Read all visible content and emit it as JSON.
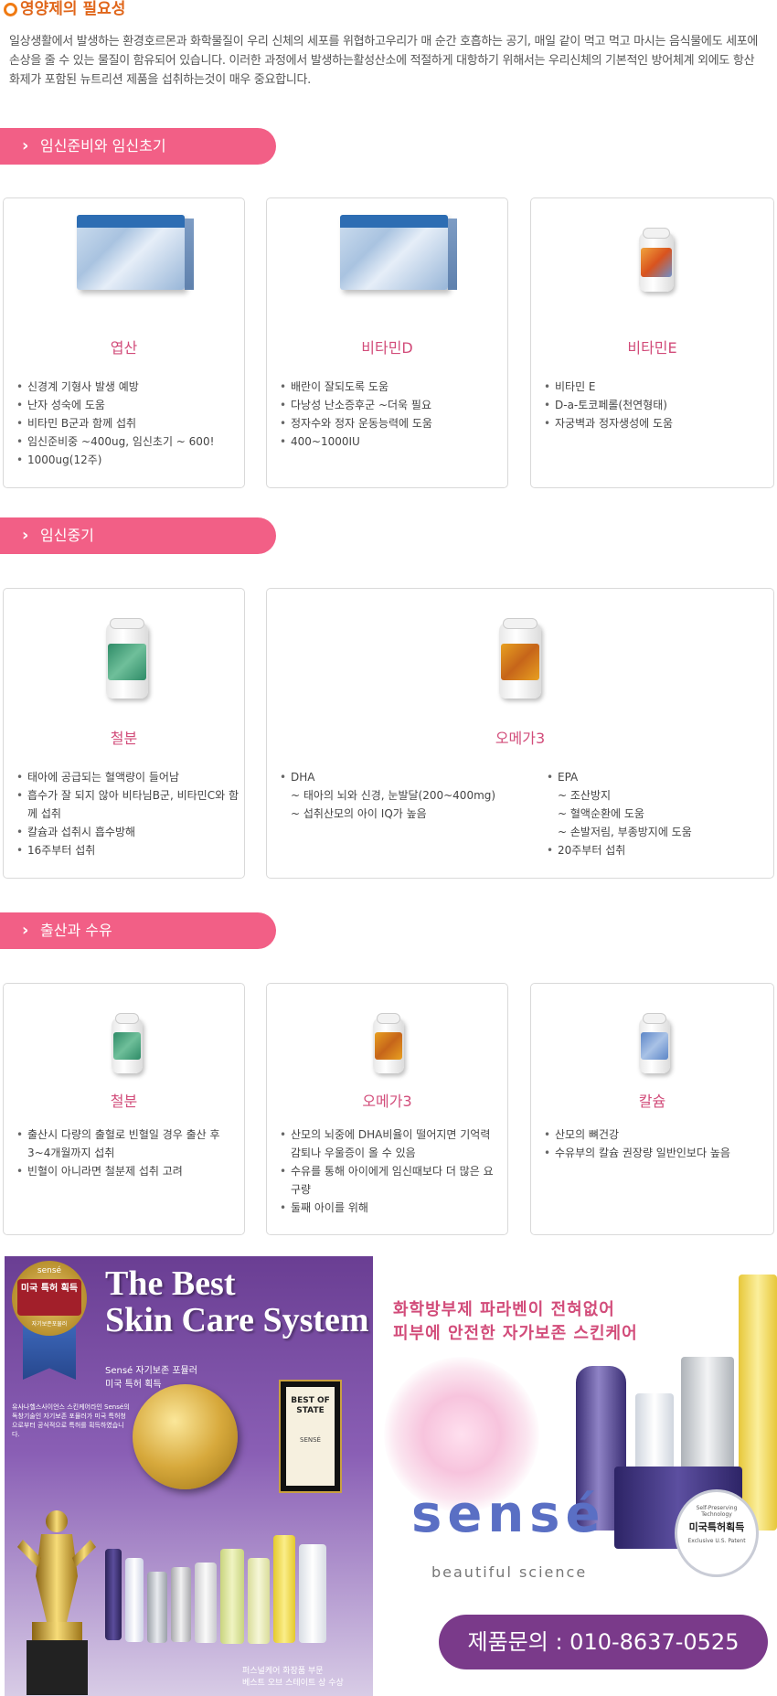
{
  "header": {
    "title": "영양제의 필요성",
    "intro": "일상생활에서 발생하는 환경호르몬과 화학물질이 우리 신체의 세포를 위협하고우리가 매 순간 호흡하는 공기, 매일 같이 먹고 먹고 마시는 음식물에도 세포에 손상을 줄 수 있는 물질이 함유되어 있습니다. 이러한 과정에서 발생하는활성산소에 적절하게 대항하기 위해서는 우리신체의 기본적인 방어체계 외에도 항산화제가 포함된 뉴트리션 제품을 섭취하는것이 매우 중요합니다."
  },
  "sections": [
    {
      "title": "임신준비와 임신초기",
      "cards": [
        {
          "name": "엽산",
          "items": [
            "신경계 기형사 발생 예방",
            "난자 성숙에 도움",
            "비타민 B군과 함께 섭취",
            "임신준비중 ~400ug, 임신초기 ~ 600!",
            "1000ug(12주)"
          ]
        },
        {
          "name": "비타민D",
          "items": [
            "배란이 잘되도록 도움",
            "다낭성 난소증후군 ~더욱 필요",
            "정자수와 정자 운동능력에 도움",
            "400~1000IU"
          ]
        },
        {
          "name": "비타민E",
          "items": [
            "비타민 E",
            "D-a-토코페롤(천연형태)",
            "자궁벽과 정자생성에 도움"
          ]
        }
      ]
    },
    {
      "title": "임신중기",
      "cards": [
        {
          "name": "철분",
          "items": [
            "태아에 공급되는 혈액량이 들어남",
            "흡수가 잘 되지 않아 비타님B군, 비타민C와 함께 섭취",
            "칼슘과 섭취시 흡수방해",
            "16주부터 섭취"
          ]
        },
        {
          "name": "오메가3",
          "dha": {
            "title": "DHA",
            "subs": [
              "~ 태아의 뇌와 신경, 눈발달(200~400mg)",
              "~ 섭취산모의 아이 IQ가 높음"
            ]
          },
          "epa": {
            "title": "EPA",
            "subs": [
              "~ 조산방지",
              "~ 혈액순환에 도움",
              "~ 손발저림, 부종방지에 도움"
            ],
            "extra": "20주부터 섭취"
          }
        }
      ]
    },
    {
      "title": "출산과 수유",
      "cards": [
        {
          "name": "철분",
          "items": [
            "출산시 다량의 출혈로 빈혈일 경우 출산 후 3~4개월까지 섭취",
            "빈혈이 아니라면 철분제 섭취 고려"
          ]
        },
        {
          "name": "오메가3",
          "items": [
            "산모의 뇌중에 DHA비율이 떨어지면 기억력 감퇴나 우울증이 올 수 있음",
            "수유를 통해 아이에게 임신때보다 더 많은 요구량",
            "둘째 아이를 위해"
          ]
        },
        {
          "name": "칼슘",
          "items": [
            "산모의 뼈건강",
            "수유부의 칼슘 권장량 일반인보다 높음"
          ]
        }
      ]
    }
  ],
  "ads": {
    "left": {
      "brand": "sensé",
      "seal_top": "sensé",
      "seal_text": "미국 특허 획득",
      "seal_small": "자기보존포뮬러",
      "headline_1": "The Best",
      "headline_2": "Skin Care System",
      "sub_1": "Sensé 자기보존 포뮬러",
      "sub_2": "미국 특허 획득",
      "body": "유사나헬스사이언스 스킨케어라인 Sensé의 독창기술인 자기보존 포뮬러가 미국 특허청으로부터 공식적으로 특허를 획득하였습니다.",
      "caption_1": "퍼스널케어 화장품 부문",
      "caption_2": "베스트 오브 스테이트 상 수상",
      "plaque_1": "BEST OF STATE",
      "plaque_2": "SENSÉ"
    },
    "right": {
      "headline_1": "화학방부제 파라벤이 전혀없어",
      "headline_2": "피부에 안전한 자가보존 스킨케어",
      "logo": "sensé",
      "tagline": "beautiful science",
      "badge": "미국특허획득",
      "badge_top": "Self-Preserving Technology",
      "badge_small": "Exclusive U.S. Patent"
    },
    "cta": "제품문의 : 010-8637-0525"
  }
}
